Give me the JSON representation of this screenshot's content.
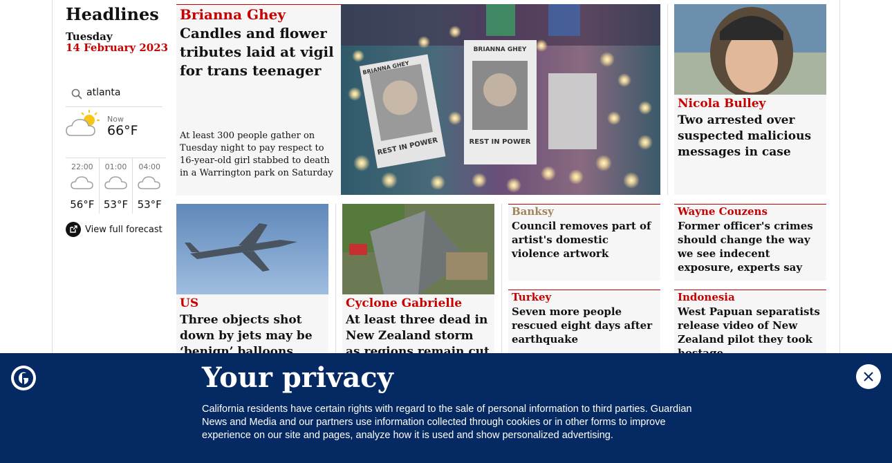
{
  "sidebar": {
    "title": "Headlines",
    "day": "Tuesday",
    "date": "14 February 2023",
    "search_value": "atlanta",
    "now_label": "Now",
    "now_temp": "66°F",
    "forecast": [
      {
        "time": "22:00",
        "temp": "56°F"
      },
      {
        "time": "01:00",
        "temp": "53°F"
      },
      {
        "time": "04:00",
        "temp": "53°F"
      }
    ],
    "full_forecast": "View full forecast"
  },
  "main_story": {
    "kicker": "Brianna Ghey",
    "headline": "Candles and flower tributes laid at vigil for trans teenager",
    "standfirst": "At least 300 people gather on Tuesday night to pay respect to 16-year-old girl stabbed to death in a Warrington park on Saturday",
    "image_text": {
      "name": "BRIANNA GHEY",
      "left_card": "REST IN POWER",
      "center_card": "REST IN POWER",
      "left_name": "BRIANNA GHEY"
    }
  },
  "side_story": {
    "kicker": "Nicola Bulley",
    "headline": "Two arrested over suspected malicious messages in case"
  },
  "stories": [
    {
      "kicker": "US",
      "headline": "Three objects shot down by jets may be ‘benign’ balloons"
    },
    {
      "kicker": "Cyclone Gabrielle",
      "headline": "At least three dead in New Zealand storm as regions remain cut off"
    },
    {
      "kicker": "Banksy",
      "headline": "Council removes part of artist's domestic violence artwork"
    },
    {
      "kicker": "Wayne Couzens",
      "headline": "Former officer's crimes should change the way we see indecent exposure, experts say"
    },
    {
      "kicker": "Turkey",
      "headline": "Seven more people rescued eight days after earthquake"
    },
    {
      "kicker": "Indonesia",
      "headline": "West Papuan separatists release video of New Zealand pilot they took hostage"
    }
  ],
  "privacy": {
    "title": "Your privacy",
    "body": "California residents have certain rights with regard to the sale of personal information to third parties. Guardian News and Media and our partners use information collected through cookies or in other forms to improve experience on our site and pages, analyze how it is used and show personalized advertising."
  },
  "colors": {
    "kicker": "#c70000",
    "banner": "#052962",
    "card_bg": "#f6f6f6",
    "kicker_culture": "#a1845c"
  }
}
